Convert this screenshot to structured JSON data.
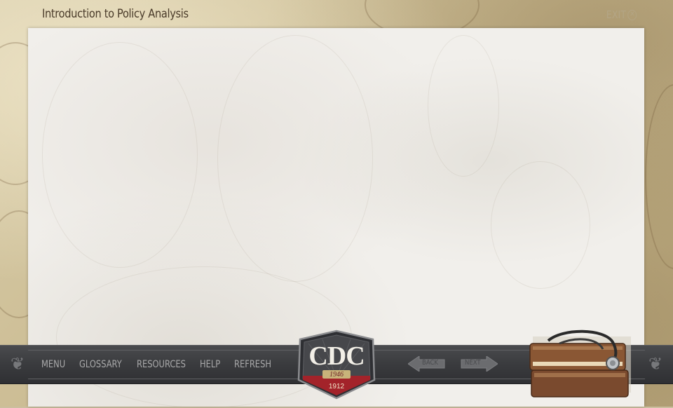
{
  "header": {
    "title": "Introduction to Policy Analysis",
    "exit_label": "EXIT",
    "exit_icon": "close-circle-icon"
  },
  "nav": {
    "menu_items": [
      {
        "label": "MENU"
      },
      {
        "label": "GLOSSARY"
      },
      {
        "label": "RESOURCES"
      },
      {
        "label": "HELP"
      },
      {
        "label": "REFRESH"
      }
    ],
    "back_label": "BACK",
    "next_label": "NEXT"
  },
  "logo": {
    "text": "CDC",
    "year_left": "1946",
    "year_right": "1912",
    "colors": {
      "badge": "#3b3c40",
      "red": "#a3232a",
      "gold": "#c8b37a"
    }
  },
  "colors": {
    "navbar": "#3a3b3e",
    "menu_text": "#a9a9aa",
    "title_text": "#4a3b2a",
    "content_bg": "#f1efeb",
    "background": "#cbbf9e"
  }
}
